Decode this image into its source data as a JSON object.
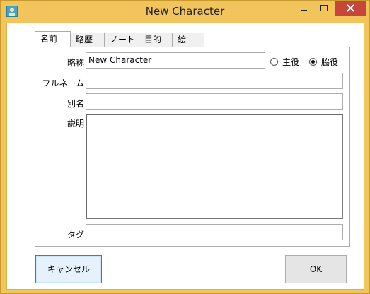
{
  "window": {
    "title": "New Character"
  },
  "tabs": [
    {
      "label": "名前",
      "active": true
    },
    {
      "label": "略歴",
      "active": false
    },
    {
      "label": "ノート",
      "active": false
    },
    {
      "label": "目的",
      "active": false
    },
    {
      "label": "絵",
      "active": false
    }
  ],
  "form": {
    "short_name_label": "略称",
    "short_name_value": "New Character",
    "role_options": [
      {
        "label": "主役",
        "selected": false
      },
      {
        "label": "脇役",
        "selected": true
      }
    ],
    "full_name_label": "フルネーム",
    "full_name_value": "",
    "alias_label": "別名",
    "alias_value": "",
    "description_label": "説明",
    "description_value": "",
    "tags_label": "タグ",
    "tags_value": ""
  },
  "buttons": {
    "cancel": "キャンセル",
    "ok": "OK"
  },
  "colors": {
    "frame": "#f2c55c",
    "close": "#c7463b",
    "focus": "#3c7fb1"
  },
  "icons": [
    "app-icon",
    "minimize-icon",
    "maximize-icon",
    "close-icon"
  ]
}
